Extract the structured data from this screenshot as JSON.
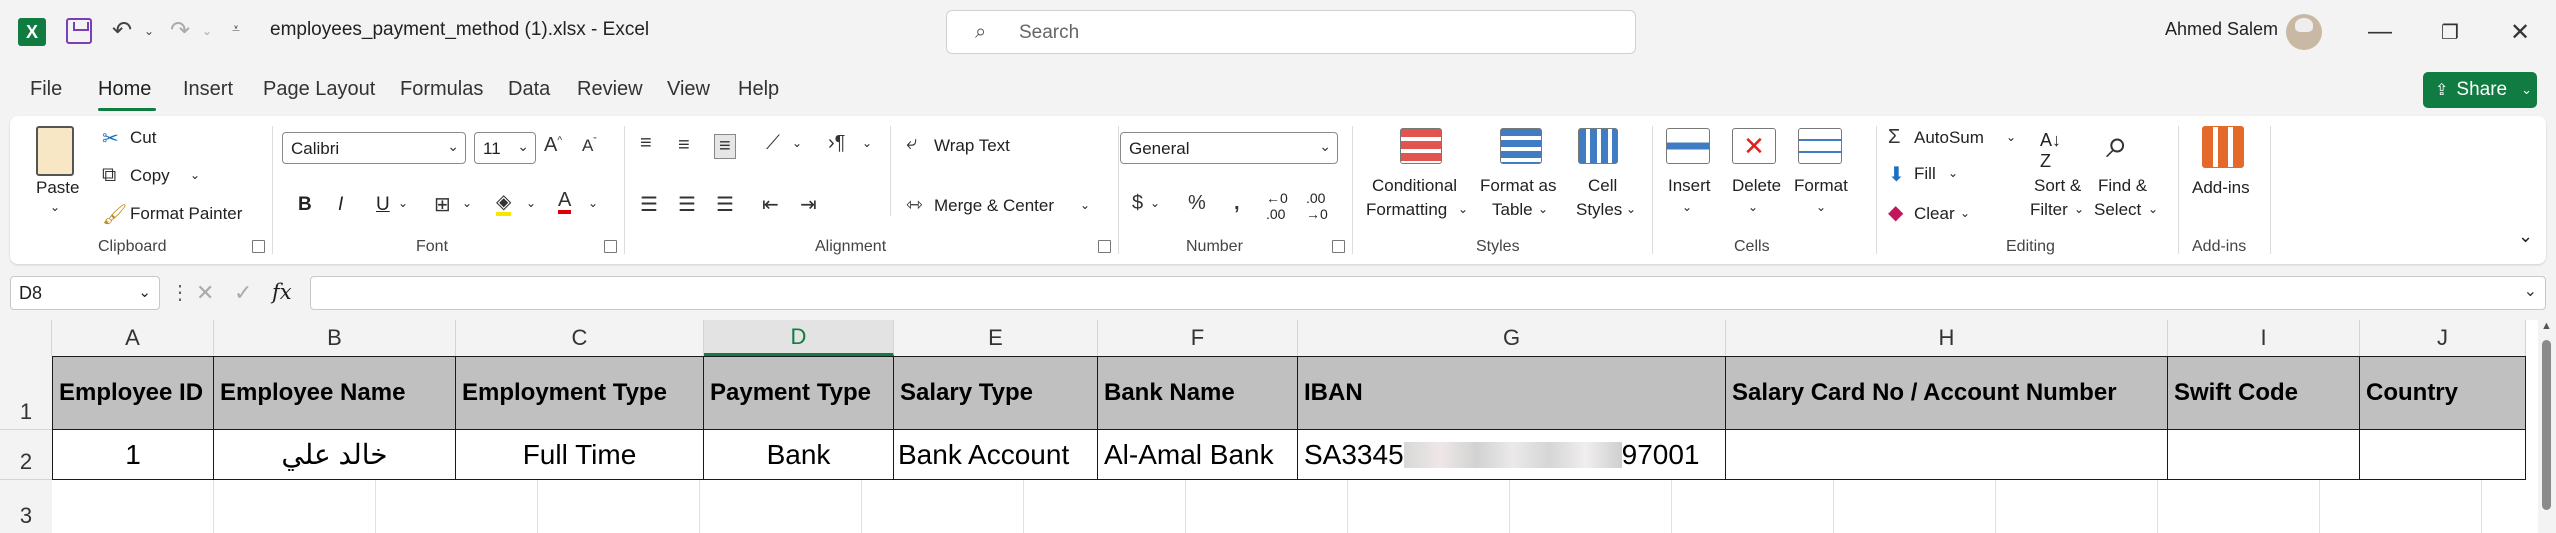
{
  "titlebar": {
    "filename": "employees_payment_method (1).xlsx",
    "separator": "-",
    "app": "Excel",
    "search_placeholder": "Search",
    "user": "Ahmed Salem"
  },
  "menu": {
    "items": [
      "File",
      "Home",
      "Insert",
      "Page Layout",
      "Formulas",
      "Data",
      "Review",
      "View",
      "Help"
    ],
    "active": "Home",
    "share_label": "Share"
  },
  "ribbon": {
    "clipboard": {
      "paste": "Paste",
      "cut": "Cut",
      "copy": "Copy",
      "format_painter": "Format Painter",
      "label": "Clipboard"
    },
    "font": {
      "name": "Calibri",
      "size": "11",
      "label": "Font",
      "bold": "B",
      "italic": "I",
      "underline": "U"
    },
    "alignment": {
      "wrap": "Wrap Text",
      "merge": "Merge & Center",
      "label": "Alignment"
    },
    "number": {
      "format": "General",
      "label": "Number"
    },
    "styles": {
      "conditional_1": "Conditional",
      "conditional_2": "Formatting",
      "format_table_1": "Format as",
      "format_table_2": "Table",
      "cell_styles_1": "Cell",
      "cell_styles_2": "Styles",
      "label": "Styles"
    },
    "cells": {
      "insert": "Insert",
      "delete": "Delete",
      "format": "Format",
      "label": "Cells"
    },
    "editing": {
      "autosum": "AutoSum",
      "fill": "Fill",
      "clear": "Clear",
      "sort_1": "Sort &",
      "sort_2": "Filter",
      "find_1": "Find &",
      "find_2": "Select",
      "label": "Editing"
    },
    "addins": {
      "button": "Add-ins",
      "label": "Add-ins"
    }
  },
  "formula_bar": {
    "cell_ref": "D8",
    "fx": "fx",
    "value": ""
  },
  "sheet": {
    "columns": [
      "A",
      "B",
      "C",
      "D",
      "E",
      "F",
      "G",
      "H",
      "I",
      "J"
    ],
    "selected_column": "D",
    "rows": [
      "1",
      "2",
      "3"
    ],
    "headers": [
      "Employee ID",
      "Employee Name",
      "Employment Type",
      "Payment Type",
      "Salary Type",
      "Bank Name",
      "IBAN",
      "Salary Card No / Account Number",
      "Swift Code",
      "Country"
    ],
    "data": [
      {
        "employee_id": "1",
        "employee_name": "خالد علي",
        "employment_type": "Full Time",
        "payment_type": "Bank",
        "salary_type": "Bank Account",
        "bank_name": "Al-Amal Bank",
        "iban_start": "SA3345",
        "iban_end": "97001",
        "account_number": "",
        "swift_code": "",
        "country": ""
      }
    ]
  }
}
